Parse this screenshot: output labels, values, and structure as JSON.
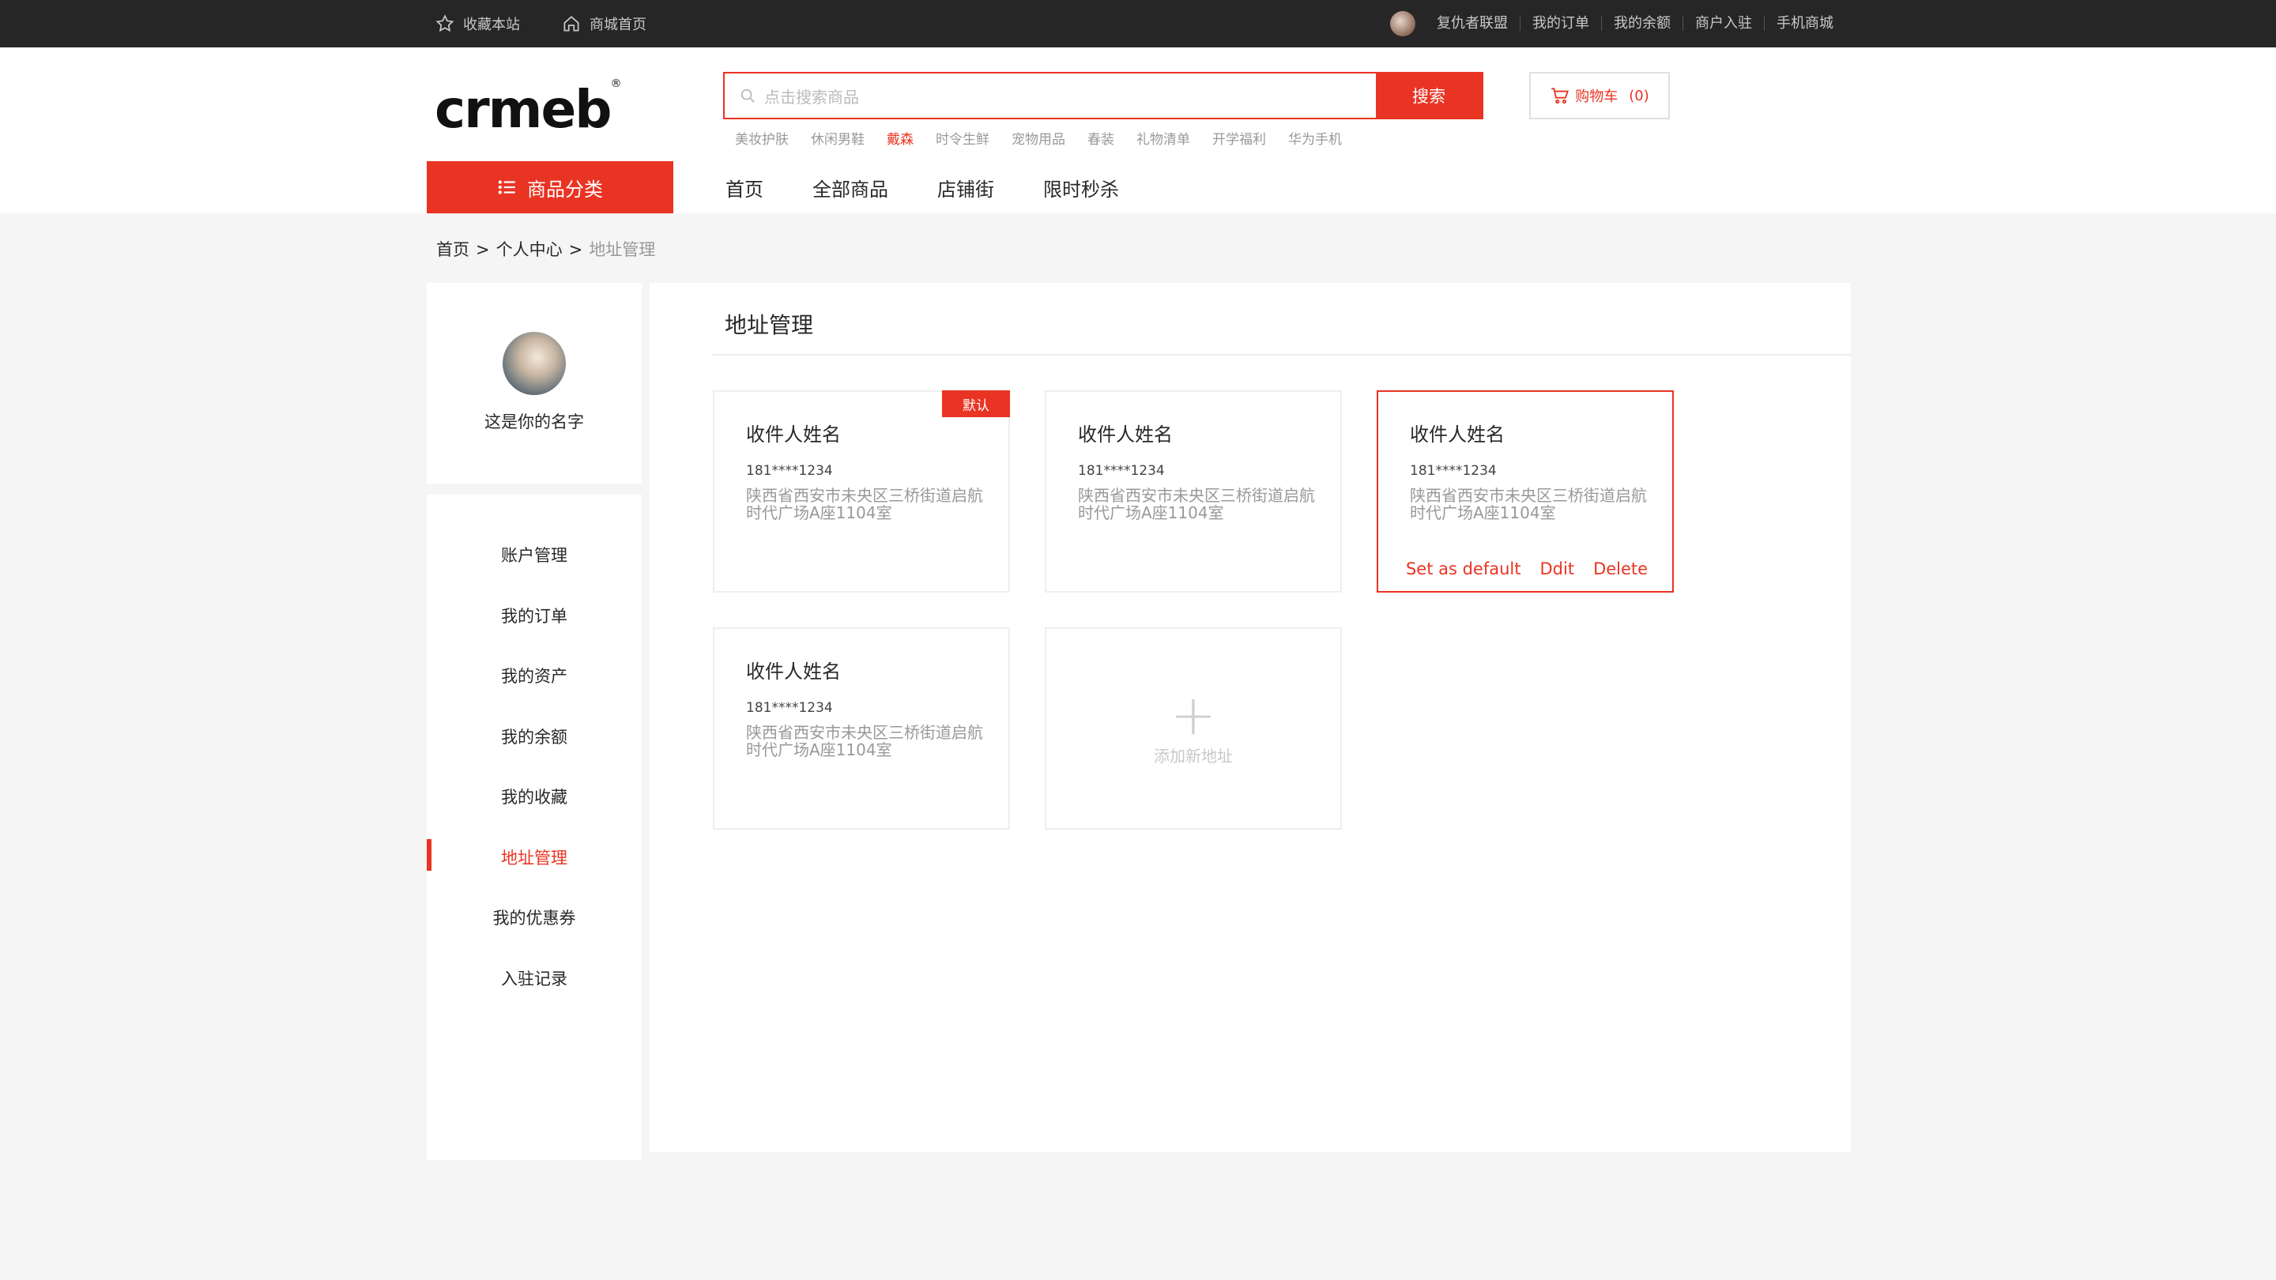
{
  "topbar": {
    "favorite": "收藏本站",
    "mall_home": "商城首页",
    "username": "复仇者联盟",
    "links": [
      "我的订单",
      "我的余额",
      "商户入驻",
      "手机商城"
    ]
  },
  "header": {
    "logo": "crmeb",
    "logo_mark": "®",
    "search_placeholder": "点击搜索商品",
    "search_button": "搜索",
    "hot_words": [
      "美妆护肤",
      "休闲男鞋",
      "戴森",
      "时令生鲜",
      "宠物用品",
      "春装",
      "礼物清单",
      "开学福利",
      "华为手机"
    ],
    "active_hot_word_index": 2,
    "cart_label": "购物车",
    "cart_count": "(0)",
    "category_button": "商品分类",
    "nav": [
      "首页",
      "全部商品",
      "店铺街",
      "限时秒杀"
    ]
  },
  "breadcrumb": {
    "home": "首页",
    "center": "个人中心",
    "current": "地址管理",
    "sep": ">"
  },
  "sidebar": {
    "username": "这是你的名字",
    "menu": [
      "账户管理",
      "我的订单",
      "我的资产",
      "我的余额",
      "我的收藏",
      "地址管理",
      "我的优惠券",
      "入驻记录"
    ],
    "active_index": 5
  },
  "main": {
    "title": "地址管理",
    "default_badge": "默认",
    "addresses": [
      {
        "name": "收件人姓名",
        "phone": "181****1234",
        "address": "陕西省西安市未央区三桥街道启航时代广场A座1104室",
        "is_default": true
      },
      {
        "name": "收件人姓名",
        "phone": "181****1234",
        "address": "陕西省西安市未央区三桥街道启航时代广场A座1104室",
        "is_default": false
      },
      {
        "name": "收件人姓名",
        "phone": "181****1234",
        "address": "陕西省西安市未央区三桥街道启航时代广场A座1104室",
        "is_default": false
      },
      {
        "name": "收件人姓名",
        "phone": "181****1234",
        "address": "陕西省西安市未央区三桥街道启航时代广场A座1104室",
        "is_default": false
      }
    ],
    "actions": {
      "set_default": "Set as default",
      "edit": "Ddit",
      "delete": "Delete"
    },
    "add_new": "添加新地址",
    "add_symbol": "+"
  },
  "colors": {
    "accent": "#e93323",
    "topbar": "#262626"
  }
}
